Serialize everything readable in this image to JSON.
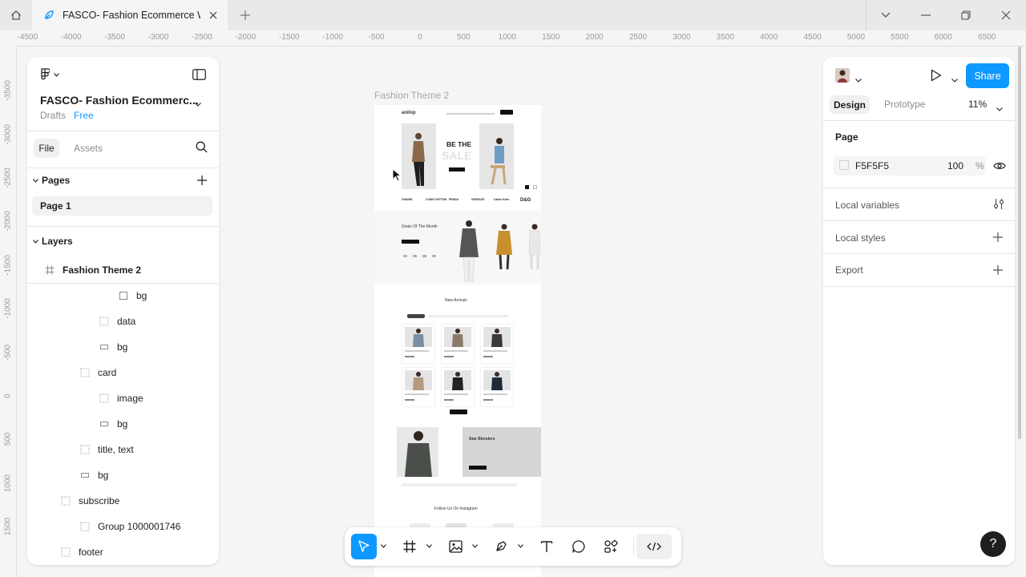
{
  "browser": {
    "tab_title": "FASCO- Fashion Ecommerce Website",
    "home_icon": "home-icon",
    "close_icon": "close-icon",
    "new_tab_icon": "plus-icon"
  },
  "rulers": {
    "top": [
      "-4500",
      "-4000",
      "-3500",
      "-3000",
      "-2500",
      "-2000",
      "-1500",
      "-1000",
      "-500",
      "0",
      "500",
      "1000",
      "1500",
      "2000",
      "2500",
      "3000",
      "3500",
      "4000",
      "4500",
      "5000",
      "5500",
      "6000",
      "6500"
    ],
    "left": [
      "-3500",
      "-3000",
      "-2500",
      "-2000",
      "-1500",
      "-1000",
      "-500",
      "0",
      "500",
      "1000",
      "1500"
    ]
  },
  "left_panel": {
    "file_name": "FASCO- Fashion Ecommerc...",
    "drafts": "Drafts",
    "plan": "Free",
    "tab_file": "File",
    "tab_assets": "Assets",
    "pages_label": "Pages",
    "pages": [
      "Page 1"
    ],
    "layers_label": "Layers",
    "layers": [
      {
        "name": "Fashion Theme 2",
        "icon": "frame-icon"
      },
      {
        "name": "bg",
        "icon": "rectangle-icon"
      },
      {
        "name": "data",
        "icon": "group-icon"
      },
      {
        "name": "bg",
        "icon": "rectangle-icon"
      },
      {
        "name": "card",
        "icon": "group-icon"
      },
      {
        "name": "image",
        "icon": "group-icon"
      },
      {
        "name": "bg",
        "icon": "rectangle-icon"
      },
      {
        "name": "title, text",
        "icon": "group-icon"
      },
      {
        "name": "bg",
        "icon": "rectangle-icon"
      },
      {
        "name": "subscribe",
        "icon": "group-icon"
      },
      {
        "name": "Group 1000001746",
        "icon": "group-icon"
      },
      {
        "name": "footer",
        "icon": "group-icon"
      }
    ]
  },
  "canvas": {
    "frame_label": "Fashion Theme 2",
    "design": {
      "logo": "anilop",
      "hero_line1": "BE THE",
      "hero_line2": "SALE",
      "brands": [
        "CHANEL",
        "LOUIS VUITTON",
        "PRADA",
        "VERSACE",
        "Calvin Klein",
        "D&G"
      ],
      "deals_title": "Deals Of The Month",
      "deals_counters": [
        "02",
        "06",
        "05",
        "30"
      ],
      "new_title": "New Arrivals",
      "star_title": "Star Blenders",
      "ig_title": "Follow Us On Instagram"
    }
  },
  "right_panel": {
    "share": "Share",
    "tab_design": "Design",
    "tab_prototype": "Prototype",
    "zoom": "11%",
    "page_label": "Page",
    "fill_hex": "F5F5F5",
    "fill_opacity": "100",
    "fill_unit": "%",
    "local_variables": "Local variables",
    "local_styles": "Local styles",
    "export": "Export"
  },
  "toolbar": {
    "tools": [
      "move-icon",
      "frame-icon",
      "image-icon",
      "pen-icon",
      "text-icon",
      "comment-icon",
      "actions-icon",
      "dev-mode-icon"
    ]
  },
  "help": "?"
}
